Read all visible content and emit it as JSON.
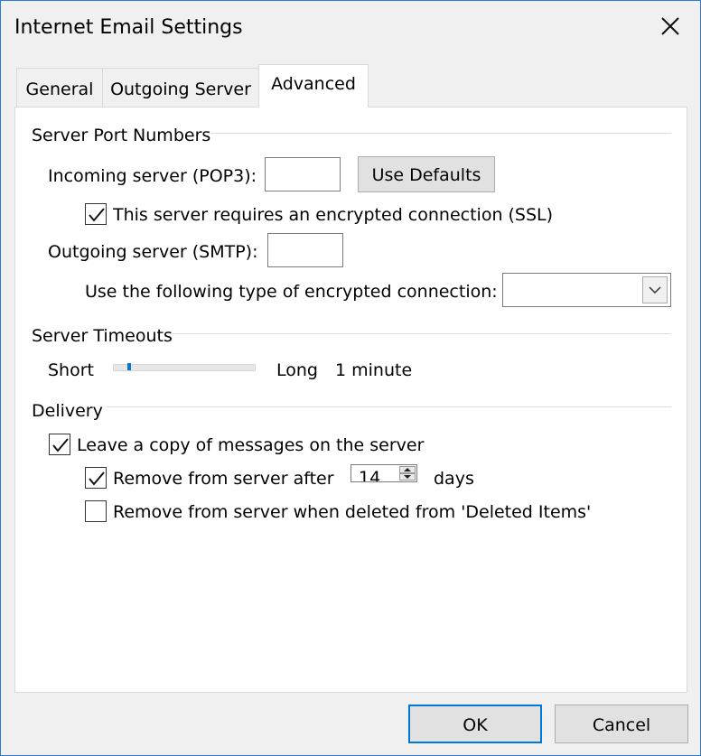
{
  "window": {
    "title": "Internet Email Settings"
  },
  "tabs": [
    {
      "label": "General"
    },
    {
      "label": "Outgoing Server"
    },
    {
      "label": "Advanced"
    }
  ],
  "port_numbers": {
    "heading": "Server Port Numbers",
    "incoming_label": "Incoming server (POP3):",
    "incoming_value": "",
    "use_defaults": "Use Defaults",
    "ssl_label": "This server requires an encrypted connection (SSL)",
    "ssl_checked": true,
    "outgoing_label": "Outgoing server (SMTP):",
    "outgoing_value": "",
    "encryption_label": "Use the following type of encrypted connection:",
    "encryption_value": ""
  },
  "timeouts": {
    "heading": "Server Timeouts",
    "short_label": "Short",
    "long_label": "Long",
    "value_text": "1 minute",
    "slider_fraction": 0.1
  },
  "delivery": {
    "heading": "Delivery",
    "leave_copy_label": "Leave a copy of messages on the server",
    "leave_copy_checked": true,
    "remove_after_label": "Remove from server after",
    "remove_after_checked": true,
    "days_value": "14",
    "days_label": "days",
    "remove_deleted_label": "Remove from server when deleted from 'Deleted Items'",
    "remove_deleted_checked": false
  },
  "footer": {
    "ok": "OK",
    "cancel": "Cancel"
  },
  "colors": {
    "accent": "#0078d7",
    "border": "#2b79d9"
  }
}
